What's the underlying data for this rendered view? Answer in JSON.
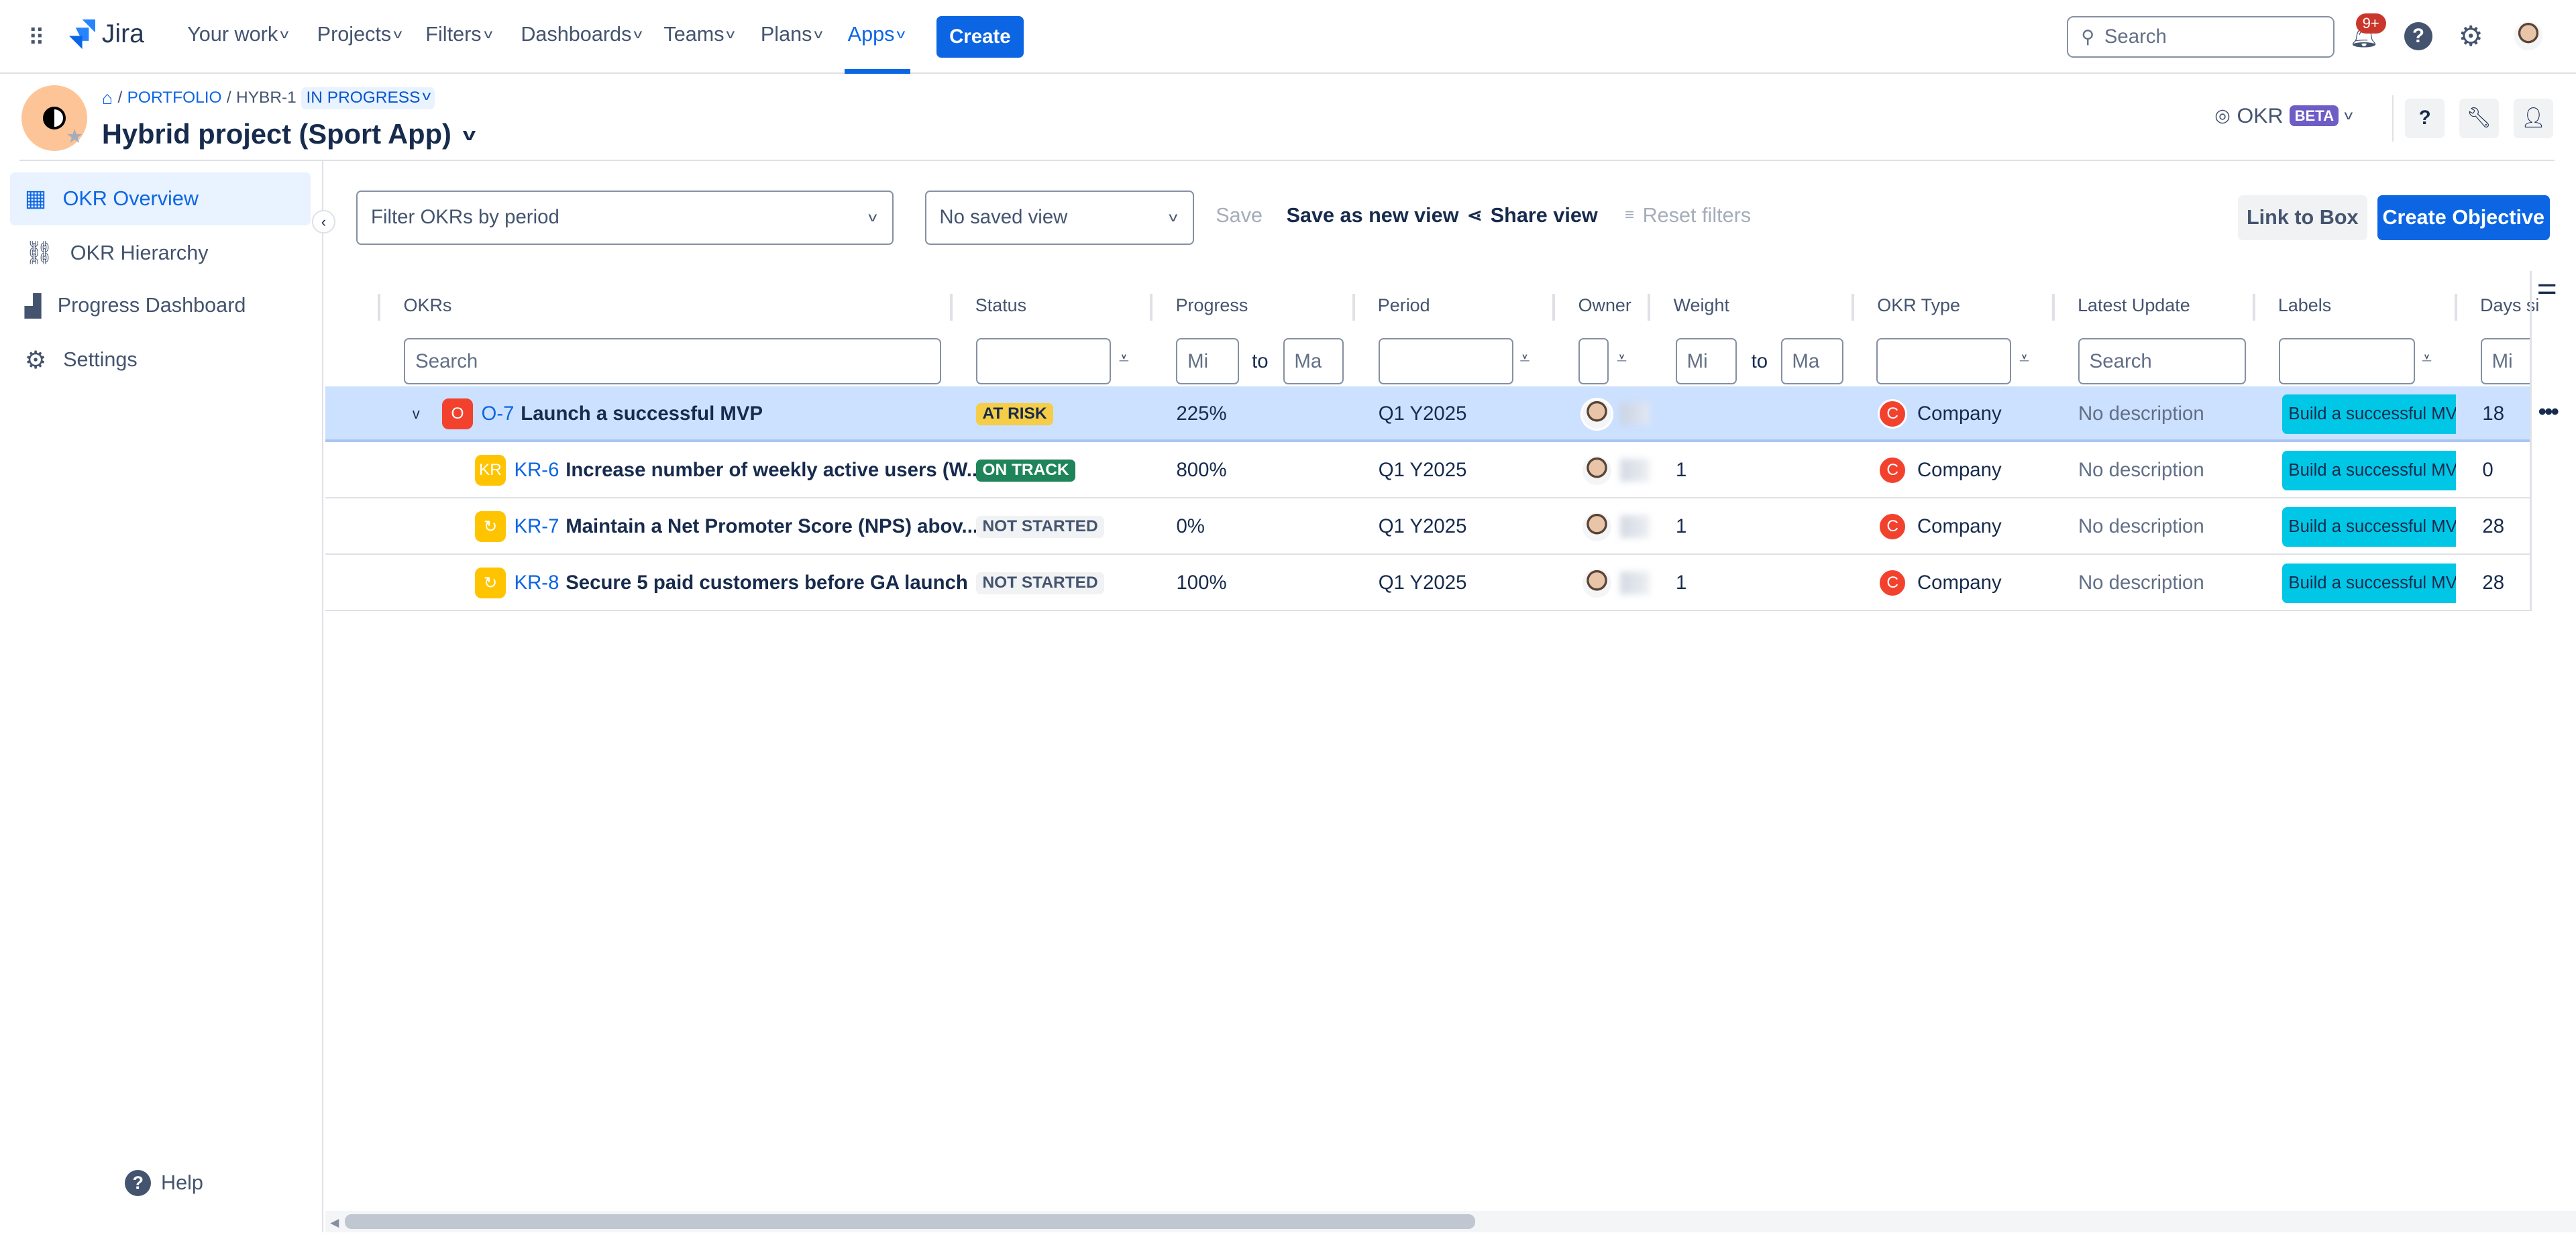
{
  "nav": {
    "brand": "Jira",
    "items": [
      {
        "label": "Your work"
      },
      {
        "label": "Projects"
      },
      {
        "label": "Filters"
      },
      {
        "label": "Dashboards"
      },
      {
        "label": "Teams"
      },
      {
        "label": "Plans"
      },
      {
        "label": "Apps",
        "active": true
      }
    ],
    "create_label": "Create",
    "search_placeholder": "Search",
    "notifications_badge": "9+"
  },
  "project": {
    "breadcrumb": {
      "portfolio": "PORTFOLIO",
      "issue": "HYBR-1",
      "status": "IN PROGRESS"
    },
    "title": "Hybrid project (Sport App)",
    "okr_label": "OKR",
    "beta_label": "BETA"
  },
  "sidebar": {
    "items": [
      {
        "label": "OKR Overview",
        "icon": "table-icon",
        "active": true
      },
      {
        "label": "OKR Hierarchy",
        "icon": "hierarchy-icon"
      },
      {
        "label": "Progress Dashboard",
        "icon": "bar-chart-icon"
      },
      {
        "label": "Settings",
        "icon": "gear-icon"
      }
    ],
    "help_label": "Help"
  },
  "toolbar": {
    "period_placeholder": "Filter OKRs by period",
    "saved_view": "No saved view",
    "save_label": "Save",
    "save_as_new_label": "Save as new view",
    "share_label": "Share view",
    "reset_label": "Reset filters",
    "link_box_label": "Link to Box",
    "create_objective_label": "Create Objective"
  },
  "table": {
    "columns": [
      "OKRs",
      "Status",
      "Progress",
      "Period",
      "Owner",
      "Weight",
      "OKR Type",
      "Latest Update",
      "Labels",
      "Days si"
    ],
    "filters": {
      "search": "Search",
      "min": "Mi",
      "max": "Ma",
      "to": "to"
    },
    "rows": [
      {
        "key": "O-7",
        "type_badge": "O",
        "title": "Launch a successful MVP",
        "status": "AT RISK",
        "status_bg": "#f5cd47",
        "status_fg": "#172b4d",
        "progress": "225%",
        "period": "Q1 Y2025",
        "weight": "",
        "okr_type_badge": "C",
        "okr_type": "Company",
        "latest_update": "No description",
        "label": "Build a successful MVP",
        "days": "18",
        "selected": true
      },
      {
        "key": "KR-6",
        "type_badge": "KR",
        "title": "Increase number of weekly active users (W...",
        "status": "ON TRACK",
        "status_bg": "#1f845a",
        "status_fg": "#ffffff",
        "progress": "800%",
        "period": "Q1 Y2025",
        "weight": "1",
        "okr_type_badge": "C",
        "okr_type": "Company",
        "latest_update": "No description",
        "label": "Build a successful MVP",
        "days": "0"
      },
      {
        "key": "KR-7",
        "type_badge": "↻",
        "title": "Maintain a Net Promoter Score (NPS) abov...",
        "status": "NOT STARTED",
        "status_bg": "#f1f2f4",
        "status_fg": "#44546f",
        "progress": "0%",
        "period": "Q1 Y2025",
        "weight": "1",
        "okr_type_badge": "C",
        "okr_type": "Company",
        "latest_update": "No description",
        "label": "Build a successful MVP",
        "days": "28"
      },
      {
        "key": "KR-8",
        "type_badge": "↻",
        "title": "Secure 5 paid customers before GA launch",
        "status": "NOT STARTED",
        "status_bg": "#f1f2f4",
        "status_fg": "#44546f",
        "progress": "100%",
        "period": "Q1 Y2025",
        "weight": "1",
        "okr_type_badge": "C",
        "okr_type": "Company",
        "latest_update": "No description",
        "label": "Build a successful MVP",
        "days": "28"
      }
    ]
  },
  "colors": {
    "accent": "#0c66e4",
    "selected_row": "#cce0ff",
    "label": "#00c7e6",
    "objective": "#f2422e",
    "key_result": "#ffc400"
  }
}
